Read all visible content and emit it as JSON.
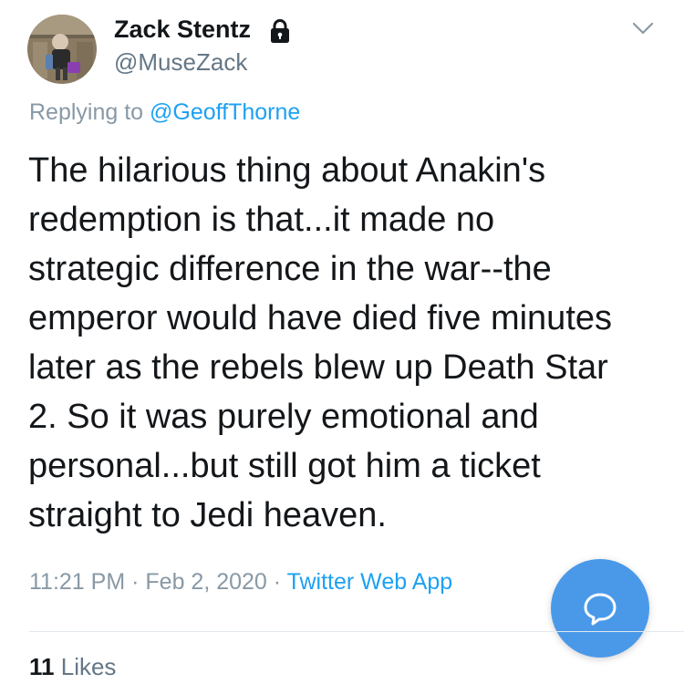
{
  "tweet": {
    "author": {
      "display_name": "Zack Stentz",
      "handle": "@MuseZack",
      "protected": true,
      "avatar_icon": "user-photo"
    },
    "reply_context": {
      "prefix": "Replying to",
      "mention": "@GeoffThorne"
    },
    "text_lines": [
      "The hilarious thing about Anakin's",
      "redemption is that...it made no",
      "strategic difference in the war--the",
      "emperor would have died five minutes",
      "later as the rebels blew up Death Star",
      "2. So it was purely emotional and",
      "personal...but still got him a ticket",
      "straight to Jedi heaven."
    ],
    "meta": {
      "time": "11:21 PM",
      "date": "Feb 2, 2020",
      "separator": "·",
      "source": "Twitter Web App"
    },
    "stats": {
      "likes_count": "11",
      "likes_label": "Likes"
    }
  },
  "colors": {
    "accent": "#1da1f2",
    "fab": "#4a99e9",
    "muted": "#8899a6",
    "text": "#14171a"
  }
}
